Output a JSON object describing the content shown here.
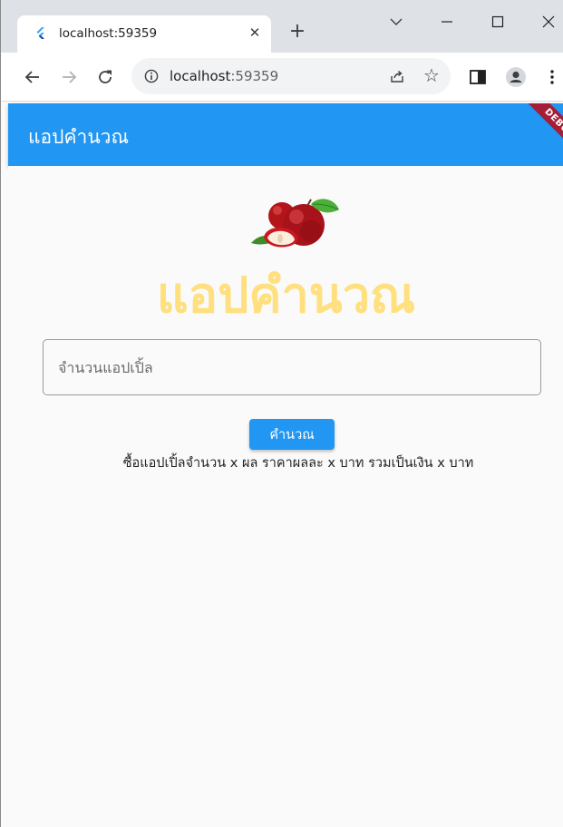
{
  "browser": {
    "tab_title": "localhost:59359",
    "url_host": "localhost",
    "url_port": ":59359"
  },
  "app": {
    "appbar_title": "แอปคำนวณ",
    "debug_label": "DEBUG",
    "heading": "แอปคำนวณ",
    "input": {
      "placeholder": "จำนวนแอปเปิ้ล",
      "value": ""
    },
    "calc_button_label": "คำนวณ",
    "result_text": "ซื้อแอปเปิ้ลจำนวน x ผล ราคาผลละ x บาท รวมเป็นเงิน x บาท"
  },
  "colors": {
    "primary": "#2196f3",
    "heading": "#ffdf7e",
    "debug_banner": "#a51e38"
  }
}
